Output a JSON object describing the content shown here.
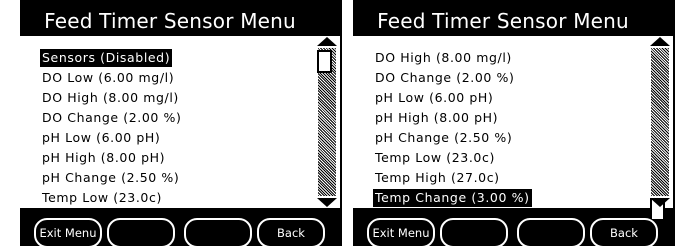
{
  "screens": [
    {
      "title": "Feed Timer Sensor Menu",
      "items": [
        {
          "label": "Sensors (Disabled)",
          "selected": true
        },
        {
          "label": "DO Low (6.00 mg/l)",
          "selected": false
        },
        {
          "label": "DO High (8.00 mg/l)",
          "selected": false
        },
        {
          "label": "DO Change (2.00 %)",
          "selected": false
        },
        {
          "label": "pH Low (6.00 pH)",
          "selected": false
        },
        {
          "label": "pH High (8.00 pH)",
          "selected": false
        },
        {
          "label": "pH Change (2.50 %)",
          "selected": false
        },
        {
          "label": "Temp Low (23.0c)",
          "selected": false
        }
      ],
      "scroll_position": "top",
      "softkeys": [
        "Exit Menu",
        "",
        "",
        "Back"
      ]
    },
    {
      "title": "Feed Timer Sensor Menu",
      "items": [
        {
          "label": "DO High (8.00 mg/l)",
          "selected": false
        },
        {
          "label": "DO Change (2.00 %)",
          "selected": false
        },
        {
          "label": "pH Low (6.00 pH)",
          "selected": false
        },
        {
          "label": "pH High (8.00 pH)",
          "selected": false
        },
        {
          "label": "pH Change (2.50 %)",
          "selected": false
        },
        {
          "label": "Temp Low (23.0c)",
          "selected": false
        },
        {
          "label": "Temp High (27.0c)",
          "selected": false
        },
        {
          "label": "Temp Change (3.00 %)",
          "selected": true
        }
      ],
      "scroll_position": "bottom",
      "softkeys": [
        "Exit Menu",
        "",
        "",
        "Back"
      ]
    }
  ],
  "icons": {
    "scroll_up": "scroll-up-arrow-icon",
    "scroll_down": "scroll-down-arrow-icon"
  },
  "colors": {
    "background": "#000000",
    "content": "#ffffff",
    "selection_bg": "#000000",
    "selection_fg": "#ffffff"
  }
}
